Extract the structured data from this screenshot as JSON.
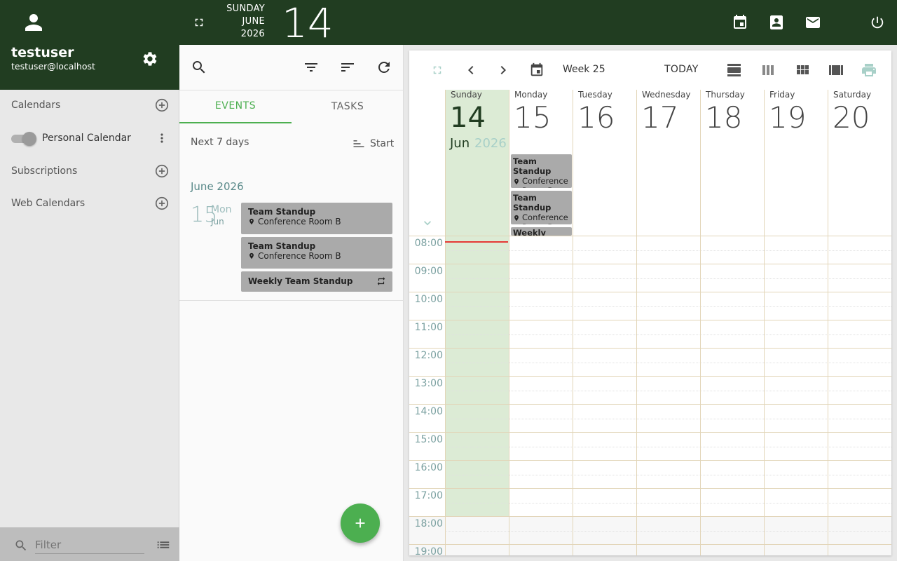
{
  "user": {
    "name": "testuser",
    "email": "testuser@localhost"
  },
  "header": {
    "weekday": "SUNDAY",
    "month": "JUNE",
    "year": "2026",
    "day": "14"
  },
  "sidebar": {
    "calendars_label": "Calendars",
    "personal_calendar": "Personal Calendar",
    "subscriptions_label": "Subscriptions",
    "web_calendars_label": "Web Calendars",
    "filter_placeholder": "Filter"
  },
  "middle": {
    "tab_events": "EVENTS",
    "tab_tasks": "TASKS",
    "range_label": "Next 7 days",
    "sort_label": "Start",
    "month_heading": "June 2026",
    "day_num": "15",
    "day_weekday": "Mon",
    "day_month": "Jun",
    "events": [
      {
        "title": "Team Standup",
        "location": "Conference Room B"
      },
      {
        "title": "Team Standup",
        "location": "Conference Room B"
      },
      {
        "title": "Weekly Team Standup",
        "location": ""
      }
    ]
  },
  "calendar": {
    "week_label": "Week 25",
    "today_label": "TODAY",
    "today_month": "Jun",
    "today_year": "2026",
    "days": [
      {
        "name": "Sunday",
        "num": "14"
      },
      {
        "name": "Monday",
        "num": "15"
      },
      {
        "name": "Tuesday",
        "num": "16"
      },
      {
        "name": "Wednesday",
        "num": "17"
      },
      {
        "name": "Thursday",
        "num": "18"
      },
      {
        "name": "Friday",
        "num": "19"
      },
      {
        "name": "Saturday",
        "num": "20"
      }
    ],
    "allday_events": [
      {
        "title": "Team Standup",
        "location": "Conference Room B"
      },
      {
        "title": "Team Standup",
        "location": "Conference Room B"
      },
      {
        "title": "Weekly Team"
      }
    ],
    "hours": [
      "08:00",
      "09:00",
      "10:00",
      "11:00",
      "12:00",
      "13:00",
      "14:00",
      "15:00",
      "16:00",
      "17:00",
      "18:00",
      "19:00"
    ]
  },
  "colors": {
    "header_bg": "#213d21",
    "accent_green": "#4caf50",
    "today_bg": "#dcebd5",
    "event_bg": "#aaaaaa",
    "now_line": "#e53935"
  }
}
